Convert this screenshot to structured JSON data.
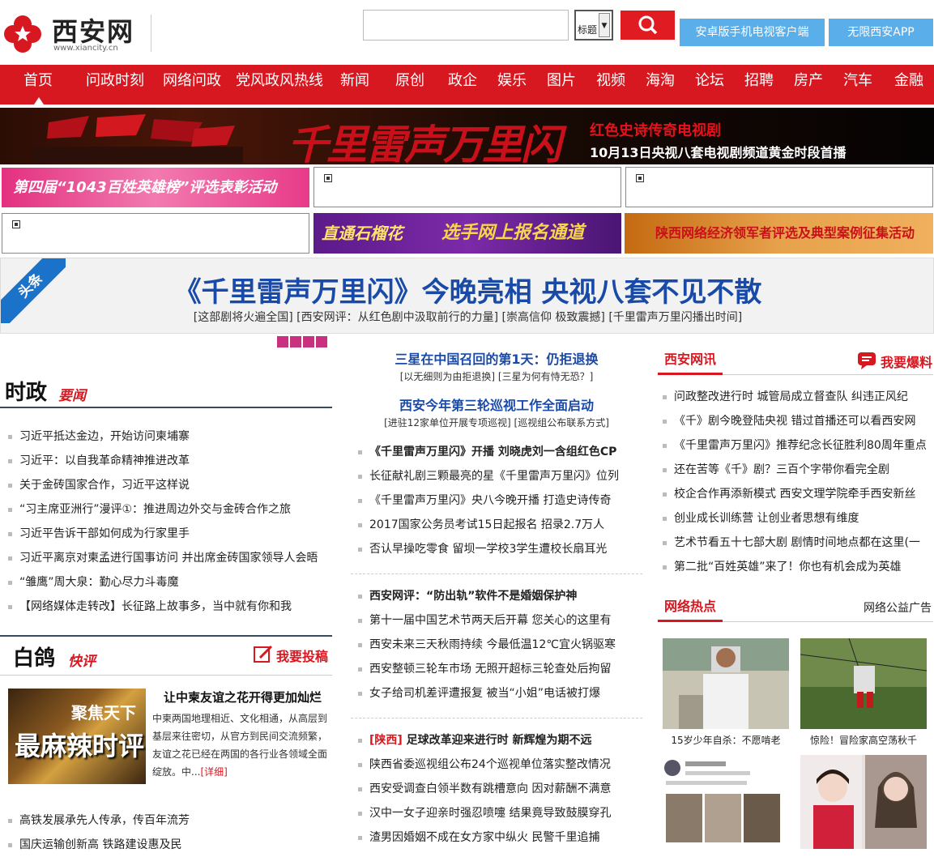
{
  "header": {
    "logo_name": "西安网",
    "logo_domain": "www.xiancity.cn",
    "search_placeholder": "",
    "search_select": "标题",
    "android_btn": "安卓版手机电视客户端",
    "app_btn": "无限西安APP",
    "colors": {
      "brand_red": "#d71820",
      "button_blue": "#5aaeea"
    }
  },
  "nav": [
    "首页",
    "问政时刻",
    "网络问政",
    "党风政风热线",
    "新闻",
    "原创",
    "政企",
    "娱乐",
    "图片",
    "视频",
    "海淘",
    "论坛",
    "招聘",
    "房产",
    "汽车",
    "金融"
  ],
  "banner": {
    "calligraphy": "千里雷声万里闪",
    "line1": "红色史诗传奇电视剧",
    "line2": "10月13日央视八套电视剧频道黄金时段首播"
  },
  "ads": {
    "pink": "第四届“1043百姓英雄榜”评选表彰活动",
    "purple_left": "直通石榴花",
    "purple_right": "选手网上报名通道",
    "orange": "陕西网络经济领军者评选及典型案例征集活动"
  },
  "headline": {
    "tag": "头条",
    "title": "《千里雷声万里闪》今晚亮相 央视八套不见不散",
    "subs": "[这部剧将火遍全国] [西安网评：从红色剧中汲取前行的力量] [崇高信仰 极致震撼] [千里雷声万里闪播出时间]"
  },
  "left": {
    "sec1_big": "时政",
    "sec1_small": "要闻",
    "news": [
      "习近平抵达金边，开始访问柬埔寨",
      "习近平：以自我革命精神推进改革",
      "关于金砖国家合作，习近平这样说",
      "“习主席亚洲行”漫评①：推进周边外交与金砖合作之旅",
      "习近平告诉干部如何成为行家里手",
      "习近平离京对柬孟进行国事访问 并出席金砖国家领导人会晤",
      "“雏鹰”周大泉：勤心尽力斗毒魔",
      "【网络媒体走转改】长征路上故事多，当中就有你和我"
    ],
    "sec2_big": "白鸽",
    "sec2_small": "快评",
    "tougao": "我要投稿",
    "comment_img_top": "聚焦天下",
    "comment_img_bottom": "最麻辣时评",
    "comment_title": "让中柬友谊之花开得更加灿烂",
    "comment_body": "中柬两国地理相近、文化相通，从高层到基层来往密切，从官方到民间交流频繁，友谊之花已经在两国的各行业各领域全面绽放。中...",
    "comment_more": "[详细]",
    "bottom": [
      "高铁发展承先人传承，传百年流芳",
      "国庆运输创新高 铁路建设惠及民"
    ]
  },
  "middle": {
    "h1": "三星在中国召回的第1天：仍拒退换",
    "s1": "[以无细则为由拒退换] [三星为何有恃无恐？]",
    "h2": "西安今年第三轮巡视工作全面启动",
    "s2": "[进驻12家单位开展专项巡视] [巡视组公布联系方式]",
    "group1": [
      "《千里雷声万里闪》开播 刘晓虎刘一含组红色CP",
      "长征献礼剧三颗最亮的星《千里雷声万里闪》位列",
      "《千里雷声万里闪》央八今晚开播 打造史诗传奇",
      "2017国家公务员考试15日起报名 招录2.7万人",
      "否认早操吃零食 留坝一学校3学生遭校长扇耳光"
    ],
    "group2_bold": "西安网评：“防出轨”软件不是婚姻保护神",
    "group2": [
      "第十一届中国艺术节两天后开幕 您关心的这里有",
      "西安未来三天秋雨持续 今最低温12℃宜火锅驱寒",
      "西安整顿三轮车市场 无照开超标三轮查处后拘留",
      "女子给司机差评遭报复 被当“小姐”电话被打爆"
    ],
    "group3_tag": "[陕西]",
    "group3_bold": "足球改革迎来进行时 新辉煌为期不远",
    "group3": [
      "陕西省委巡视组公布24个巡视单位落实整改情况",
      "西安受调查白领半数有跳槽意向 因对薪酬不满意",
      "汉中一女子迎亲时强忍喷嚏 结果竟导致鼓膜穿孔",
      "渣男因婚姻不成在女方家中纵火 民警千里追捕"
    ]
  },
  "right": {
    "sec1": "西安网讯",
    "baoliao": "我要爆料",
    "news": [
      "问政整改进行时 城管局成立督查队 纠违正风纪",
      "《千》剧今晚登陆央视 错过首播还可以看西安网",
      "《千里雷声万里闪》推荐纪念长征胜利80周年重点",
      "还在苦等《千》剧？三百个字带你看完全剧",
      "校企合作再添新模式 西安文理学院牵手西安新丝",
      "创业成长训练营 让创业者思想有维度",
      "艺术节看五十七部大剧 剧情时间地点都在这里(一",
      "第二批“百姓英雄”来了！你也有机会成为英雄"
    ],
    "sec2": "网络热点",
    "sec2_right": "网络公益广告",
    "photos": [
      "15岁少年自杀：不愿啃老",
      "惊险！冒险家高空荡秋千"
    ]
  }
}
